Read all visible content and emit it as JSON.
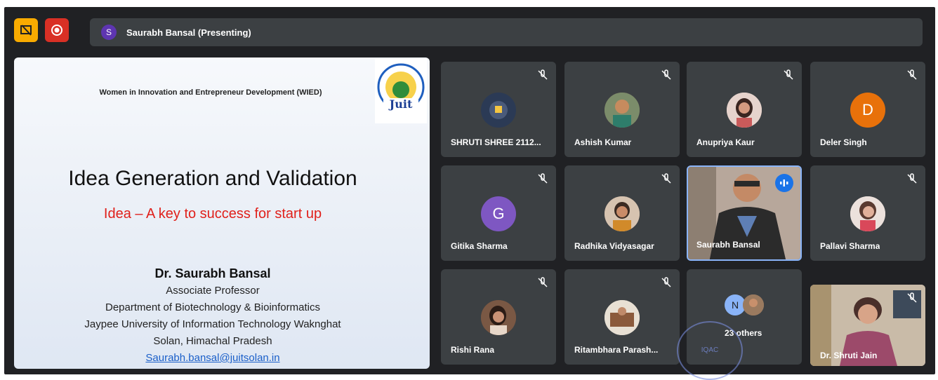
{
  "presenter": {
    "avatar_letter": "S",
    "label": "Saurabh Bansal (Presenting)"
  },
  "slide": {
    "org": "Women in Innovation and Entrepreneur Development (WIED)",
    "logo_text": "Juit",
    "title": "Idea Generation and Validation",
    "subtitle": "Idea – A key to success for start up",
    "name": "Dr. Saurabh Bansal",
    "role": "Associate Professor",
    "dept": "Department of Biotechnology & Bioinformatics",
    "university": "Jaypee University of Information Technology Waknghat",
    "location": "Solan, Himachal Pradesh",
    "email": "Saurabh.bansal@juitsolan.in"
  },
  "participants": [
    {
      "name": "SHRUTI SHREE 2112...",
      "avatar": "",
      "muted": true
    },
    {
      "name": "Ashish Kumar",
      "avatar": "",
      "muted": true
    },
    {
      "name": "Anupriya Kaur",
      "avatar": "",
      "muted": true
    },
    {
      "name": "Deler Singh",
      "avatar": "D",
      "muted": true,
      "color": "#e8710a"
    },
    {
      "name": "Gitika Sharma",
      "avatar": "G",
      "muted": true,
      "color": "#7e57c2"
    },
    {
      "name": "Radhika Vidyasagar",
      "avatar": "",
      "muted": true
    },
    {
      "name": "Saurabh Bansal",
      "avatar": "",
      "muted": false,
      "speaking": true
    },
    {
      "name": "Pallavi Sharma",
      "avatar": "",
      "muted": true
    },
    {
      "name": "Rishi Rana",
      "avatar": "",
      "muted": true
    },
    {
      "name": "Ritambhara Parash...",
      "avatar": "",
      "muted": true
    },
    {
      "name": "Dr. Shruti Jain",
      "avatar": "",
      "muted": true
    }
  ],
  "others": {
    "avatar_letter": "N",
    "label": "23 others"
  },
  "watermark": "IQAC",
  "colors": {
    "accent": "#8ab4f8",
    "record": "#d93025",
    "warn": "#f9ab00"
  }
}
